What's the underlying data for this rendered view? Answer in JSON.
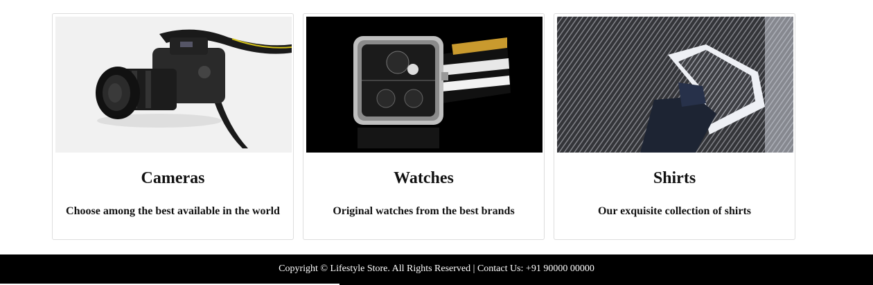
{
  "products": [
    {
      "title": "Cameras",
      "description": "Choose among the best available in the world",
      "image": "camera-photo"
    },
    {
      "title": "Watches",
      "description": "Original watches from the best brands",
      "image": "watch-photo"
    },
    {
      "title": "Shirts",
      "description": "Our exquisite collection of shirts",
      "image": "shirt-photo"
    }
  ],
  "footer": {
    "text": "Copyright © Lifestyle Store. All Rights Reserved | Contact Us: +91 90000 00000"
  },
  "colors": {
    "footer_background": "#000000",
    "footer_text": "#ffffff",
    "card_border": "#dddddd"
  }
}
